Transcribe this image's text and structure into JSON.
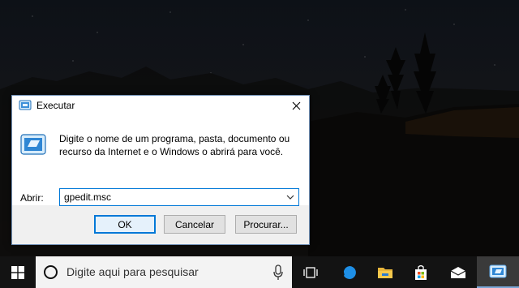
{
  "dialog": {
    "title": "Executar",
    "description": "Digite o nome de um programa, pasta, documento ou recurso da Internet e o Windows o abrirá para você.",
    "open_label": "Abrir:",
    "input_value": "gpedit.msc",
    "ok_label": "OK",
    "cancel_label": "Cancelar",
    "browse_label": "Procurar..."
  },
  "taskbar": {
    "search_placeholder": "Digite aqui para pesquisar",
    "icons": [
      "windows-start-icon",
      "cortana-icon",
      "microphone-icon",
      "task-view-icon",
      "edge-icon",
      "file-explorer-icon",
      "store-icon",
      "mail-icon",
      "run-app-icon"
    ]
  },
  "colors": {
    "accent": "#0078d7",
    "taskbar": "#131313",
    "dialog_bg": "#f0f0f0"
  }
}
